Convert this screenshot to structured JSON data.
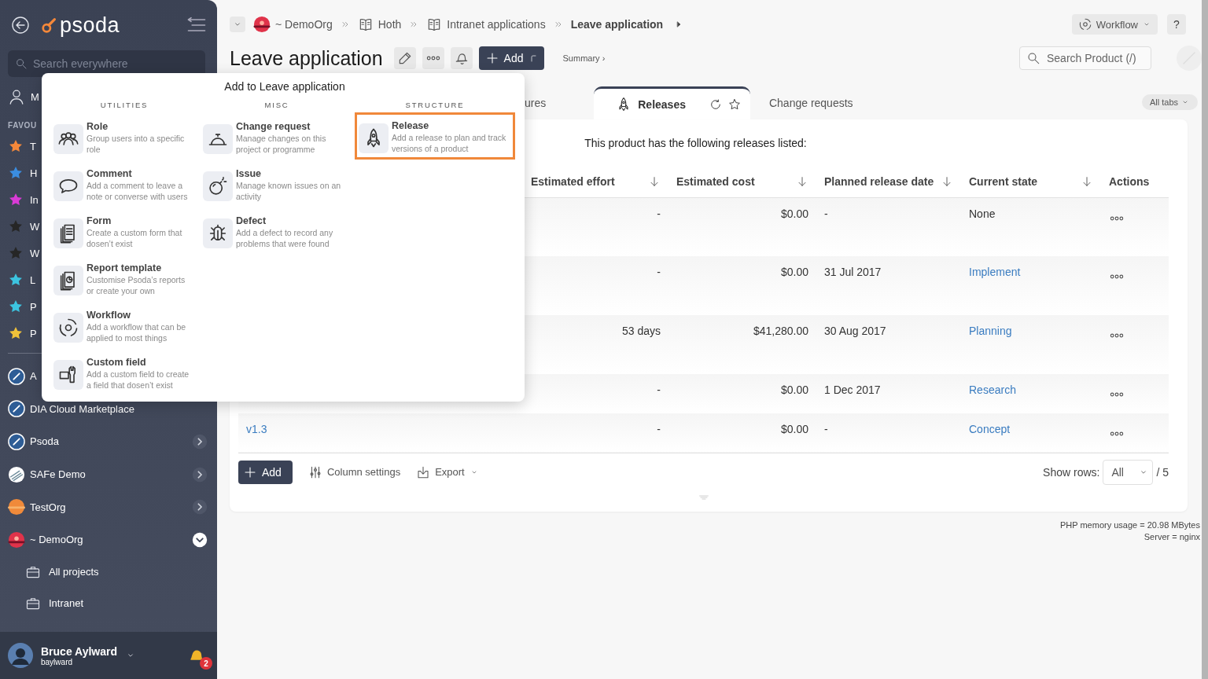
{
  "sidebar": {
    "logo": "psoda",
    "search": {
      "placeholder": "Search everywhere"
    },
    "user_item": "M",
    "favourites_heading": "FAVOU",
    "favourites": [
      {
        "label": "T",
        "color": "#f5883a"
      },
      {
        "label": "H",
        "color": "#3b8de0"
      },
      {
        "label": "In",
        "color": "#d93bd6"
      },
      {
        "label": "W",
        "color": "#262626"
      },
      {
        "label": "W",
        "color": "#262626"
      },
      {
        "label": "L",
        "color": "#3cc4e0"
      },
      {
        "label": "P",
        "color": "#3cc4e0"
      },
      {
        "label": "P",
        "color": "#f0c23a"
      }
    ],
    "organisations": [
      {
        "label": "A",
        "kind": "rocket"
      },
      {
        "label": "DIA Cloud Marketplace",
        "kind": "rocket"
      },
      {
        "label": "Psoda",
        "kind": "rocket",
        "expanded": false
      },
      {
        "label": "SAFe Demo",
        "kind": "stripes",
        "expanded": false
      },
      {
        "label": "TestOrg",
        "kind": "sun",
        "expanded": false
      },
      {
        "label": "~ DemoOrg",
        "kind": "sunset",
        "expanded": true,
        "children": [
          {
            "label": "All projects"
          },
          {
            "label": "Intranet"
          }
        ]
      }
    ],
    "user": {
      "name": "Bruce Aylward",
      "username": "baylward",
      "notifications": "2"
    }
  },
  "breadcrumb": [
    {
      "label": "~ DemoOrg",
      "kind": "org"
    },
    {
      "label": "Hoth",
      "kind": "book"
    },
    {
      "label": "Intranet applications",
      "kind": "book"
    },
    {
      "label": "Leave application",
      "kind": "current"
    }
  ],
  "top_right": {
    "workflow_button": "Workflow",
    "help_button": "?",
    "search": {
      "placeholder": "Search Product (/)"
    }
  },
  "page": {
    "title": "Leave application",
    "add_button": "Add",
    "summary_link": "Summary ›"
  },
  "tabs": [
    {
      "label": "ures",
      "selected": false
    },
    {
      "label": "Releases",
      "selected": true
    },
    {
      "label": "Change requests",
      "selected": false
    }
  ],
  "all_tabs_button": "All tabs",
  "panel": {
    "intro": "This product has the following releases listed:",
    "table": {
      "columns": [
        "Estimated effort",
        "Estimated cost",
        "Planned release date",
        "Current state",
        "Actions"
      ],
      "rows": [
        {
          "effort": "-",
          "cost": "$0.00",
          "date": "-",
          "state": "None",
          "state_linked": false
        },
        {
          "effort": "-",
          "cost": "$0.00",
          "date": "31 Jul 2017",
          "state": "Implement",
          "state_linked": true
        },
        {
          "effort": "53 days",
          "cost": "$41,280.00",
          "date": "30 Aug 2017",
          "state": "Planning",
          "state_linked": true
        },
        {
          "effort": "-",
          "cost": "$0.00",
          "date": "1 Dec 2017",
          "state": "Research",
          "state_linked": true
        },
        {
          "name": "v1.3",
          "effort": "-",
          "cost": "$0.00",
          "date": "-",
          "state": "Concept",
          "state_linked": true
        }
      ]
    },
    "add_button": "Add",
    "column_settings": "Column settings",
    "export": "Export",
    "show_rows_label": "Show rows:",
    "show_rows_value": "All",
    "row_total": "/ 5"
  },
  "footer": [
    "PHP memory usage = 20.98 MBytes",
    "Server = nginx"
  ],
  "add_menu": {
    "title": "Add to Leave application",
    "columns": [
      {
        "heading": "UTILITIES",
        "items": [
          {
            "label": "Role",
            "description": "Group users into a specific role",
            "selected": false
          },
          {
            "label": "Comment",
            "description": "Add a comment to leave a note or converse with users",
            "selected": false
          },
          {
            "label": "Form",
            "description": "Create a custom form that dosen’t exist",
            "selected": false
          },
          {
            "label": "Report template",
            "description": "Customise Psoda’s reports or create your own",
            "selected": false
          },
          {
            "label": "Workflow",
            "description": "Add a workflow that can be applied to most things",
            "selected": false
          },
          {
            "label": "Custom field",
            "description": "Add a custom field to create a field that dosen’t exist",
            "selected": false
          }
        ]
      },
      {
        "heading": "MISC",
        "items": [
          {
            "label": "Change request",
            "description": "Manage changes on this project or programme",
            "selected": false
          },
          {
            "label": "Issue",
            "description": "Manage known issues on an activity",
            "selected": false
          },
          {
            "label": "Defect",
            "description": "Add a defect to record any problems that were found",
            "selected": false
          }
        ]
      },
      {
        "heading": "STRUCTURE",
        "items": [
          {
            "label": "Release",
            "description": "Add a release to plan and track versions of a product",
            "selected": true
          }
        ]
      }
    ]
  }
}
